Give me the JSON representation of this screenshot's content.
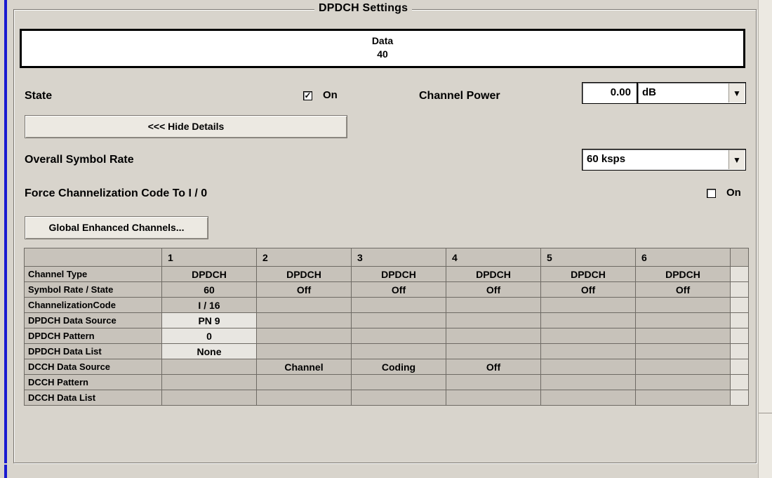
{
  "group_title": "DPDCH Settings",
  "data_box": {
    "label": "Data",
    "value": "40"
  },
  "state": {
    "label": "State",
    "checkbox_checked": true,
    "checkbox_label": "On"
  },
  "channel_power": {
    "label": "Channel Power",
    "value": "0.00",
    "unit": "dB"
  },
  "hide_details_button": "<<< Hide Details",
  "overall_symbol_rate": {
    "label": "Overall Symbol Rate",
    "value": "60 ksps"
  },
  "force_channelization": {
    "label": "Force Channelization Code To I / 0",
    "checkbox_checked": false,
    "checkbox_label": "On"
  },
  "global_enhanced_button": "Global Enhanced Channels...",
  "table": {
    "columns": [
      "1",
      "2",
      "3",
      "4",
      "5",
      "6"
    ],
    "rows": [
      {
        "label": "Channel Type",
        "cells": [
          "DPDCH",
          "DPDCH",
          "DPDCH",
          "DPDCH",
          "DPDCH",
          "DPDCH"
        ]
      },
      {
        "label": "Symbol Rate / State",
        "cells": [
          "60",
          "Off",
          "Off",
          "Off",
          "Off",
          "Off"
        ]
      },
      {
        "label": "ChannelizationCode",
        "cells": [
          "I / 16",
          "",
          "",
          "",
          "",
          ""
        ]
      },
      {
        "label": "DPDCH Data Source",
        "cells": [
          "PN 9",
          "",
          "",
          "",
          "",
          ""
        ]
      },
      {
        "label": "DPDCH Pattern",
        "cells": [
          "0",
          "",
          "",
          "",
          "",
          ""
        ]
      },
      {
        "label": "DPDCH Data List",
        "cells": [
          "None",
          "",
          "",
          "",
          "",
          ""
        ]
      },
      {
        "label": "DCCH Data Source",
        "cells": [
          "",
          "Channel",
          "Coding",
          "Off",
          "",
          ""
        ]
      },
      {
        "label": "DCCH Pattern",
        "cells": [
          "",
          "",
          "",
          "",
          "",
          ""
        ]
      },
      {
        "label": "DCCH Data List",
        "cells": [
          "",
          "",
          "",
          "",
          "",
          ""
        ]
      }
    ]
  }
}
